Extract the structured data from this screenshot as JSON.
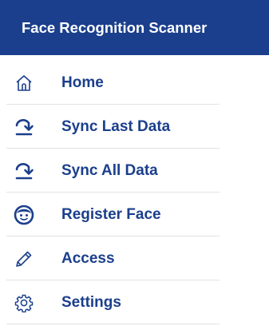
{
  "header": {
    "title": "Face Recognition Scanner"
  },
  "menu": {
    "items": [
      {
        "label": "Home",
        "icon": "home-icon"
      },
      {
        "label": "Sync Last Data",
        "icon": "sync-arrow-icon"
      },
      {
        "label": "Sync All Data",
        "icon": "sync-arrow-icon"
      },
      {
        "label": "Register Face",
        "icon": "face-icon"
      },
      {
        "label": "Access",
        "icon": "pencil-icon"
      },
      {
        "label": "Settings",
        "icon": "gear-icon"
      }
    ]
  },
  "colors": {
    "brand": "#1b3f8c",
    "divider": "#e3e3e3",
    "background": "#ffffff"
  }
}
